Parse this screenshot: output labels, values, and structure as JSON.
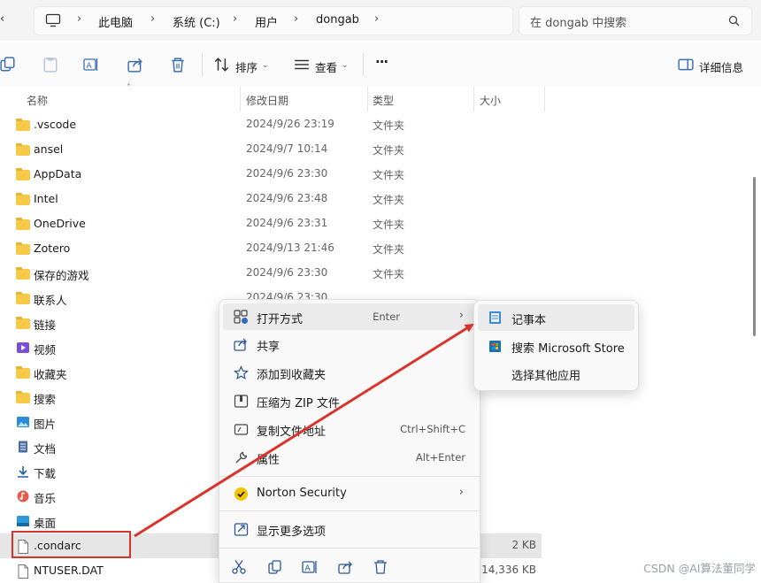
{
  "address": {
    "segments": [
      "此电脑",
      "系统 (C:)",
      "用户",
      "dongab"
    ],
    "search_placeholder": "在 dongab 中搜索"
  },
  "toolbar": {
    "sort_label": "排序",
    "view_label": "查看",
    "more_label": "···",
    "details_label": "详细信息"
  },
  "columns": {
    "name": "名称",
    "date": "修改日期",
    "type": "类型",
    "size": "大小"
  },
  "files": [
    {
      "name": ".vscode",
      "date": "2024/9/26 23:19",
      "type": "文件夹",
      "icon": "folder-icon"
    },
    {
      "name": "ansel",
      "date": "2024/9/7 10:14",
      "type": "文件夹",
      "icon": "folder-icon"
    },
    {
      "name": "AppData",
      "date": "2024/9/6 23:30",
      "type": "文件夹",
      "icon": "folder-icon"
    },
    {
      "name": "Intel",
      "date": "2024/9/6 23:48",
      "type": "文件夹",
      "icon": "folder-icon"
    },
    {
      "name": "OneDrive",
      "date": "2024/9/6 23:31",
      "type": "文件夹",
      "icon": "folder-icon"
    },
    {
      "name": "Zotero",
      "date": "2024/9/13 21:46",
      "type": "文件夹",
      "icon": "folder-icon"
    },
    {
      "name": "保存的游戏",
      "date": "2024/9/6 23:30",
      "type": "文件夹",
      "icon": "folder-icon"
    },
    {
      "name": "联系人",
      "date": "2024/9/6 23:30",
      "type": "",
      "icon": "folder-icon"
    },
    {
      "name": "链接",
      "date": "",
      "type": "",
      "icon": "folder-icon"
    },
    {
      "name": "视频",
      "date": "",
      "type": "",
      "icon": "video-icon"
    },
    {
      "name": "收藏夹",
      "date": "",
      "type": "",
      "icon": "folder-icon"
    },
    {
      "name": "搜索",
      "date": "",
      "type": "",
      "icon": "folder-icon"
    },
    {
      "name": "图片",
      "date": "",
      "type": "",
      "icon": "picture-icon"
    },
    {
      "name": "文档",
      "date": "",
      "type": "",
      "icon": "document-icon"
    },
    {
      "name": "下载",
      "date": "",
      "type": "",
      "icon": "download-icon"
    },
    {
      "name": "音乐",
      "date": "",
      "type": "",
      "icon": "music-icon"
    },
    {
      "name": "桌面",
      "date": "",
      "type": "",
      "icon": "desktop-icon"
    },
    {
      "name": ".condarc",
      "date": "",
      "type": "",
      "size": "2 KB",
      "icon": "file-icon",
      "selected": true
    },
    {
      "name": "NTUSER.DAT",
      "date": "",
      "type": "",
      "size": "14,336 KB",
      "icon": "file-icon"
    }
  ],
  "context_menu": {
    "items": [
      {
        "label": "打开方式",
        "key": "Enter",
        "icon": "open-with-icon",
        "submenu": true,
        "highlighted": true
      },
      {
        "label": "共享",
        "key": "",
        "icon": "share-icon"
      },
      {
        "label": "添加到收藏夹",
        "key": "",
        "icon": "star-icon"
      },
      {
        "label": "压缩为 ZIP 文件",
        "key": "",
        "icon": "zip-icon"
      },
      {
        "label": "复制文件地址",
        "key": "Ctrl+Shift+C",
        "icon": "copy-path-icon"
      },
      {
        "label": "属性",
        "key": "Alt+Enter",
        "icon": "wrench-icon"
      }
    ],
    "norton_label": "Norton Security",
    "more_options_label": "显示更多选项"
  },
  "submenu": {
    "items": [
      {
        "label": "记事本",
        "icon": "notepad-icon",
        "highlighted": true
      },
      {
        "label": "搜索 Microsoft Store",
        "icon": "store-icon"
      },
      {
        "label": "选择其他应用",
        "icon": ""
      }
    ]
  },
  "watermark": "CSDN @AI算法董同学",
  "colors": {
    "annotation": "#d9342b",
    "folder": "#f7c948",
    "accent": "#2b5797"
  }
}
